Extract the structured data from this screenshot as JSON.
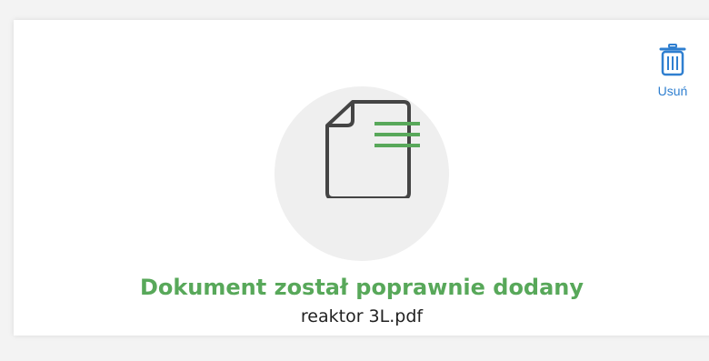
{
  "actions": {
    "delete_label": "Usuń",
    "delete_icon": "trash-icon"
  },
  "upload": {
    "status_message": "Dokument został poprawnie dodany",
    "file_name": "reaktor 3L.pdf",
    "document_icon": "document-icon"
  },
  "colors": {
    "accent_blue": "#2f7fd0",
    "success_green": "#58a85a",
    "circle_bg": "#efefef",
    "icon_dark": "#444444"
  }
}
